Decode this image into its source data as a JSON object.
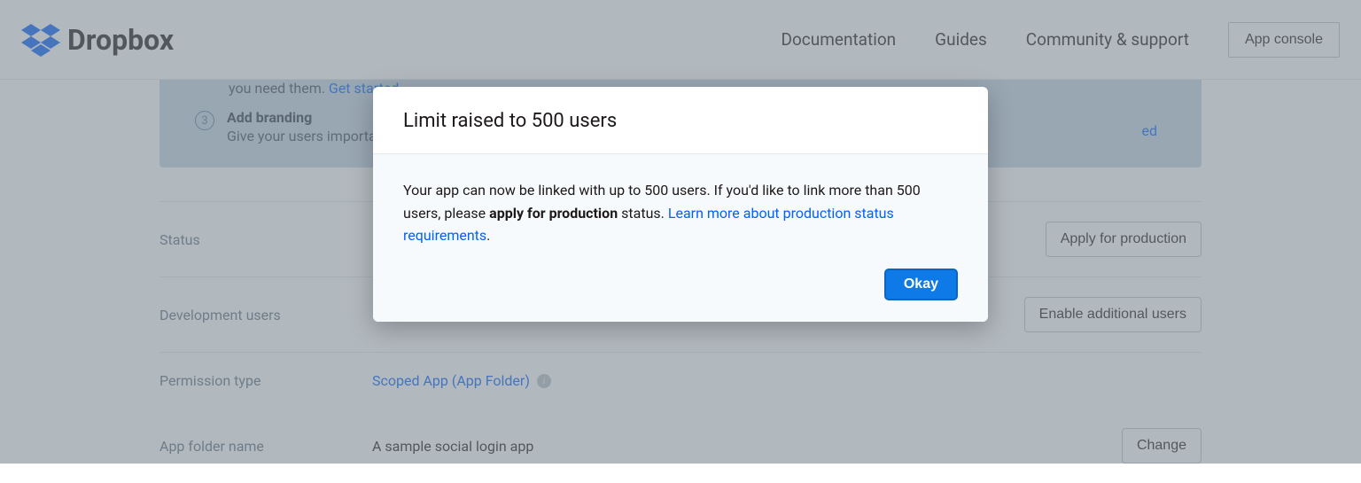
{
  "header": {
    "brand": "Dropbox",
    "nav": {
      "documentation": "Documentation",
      "guides": "Guides",
      "community": "Community & support"
    },
    "app_console": "App console"
  },
  "banner": {
    "line1_prefix": "you need them. ",
    "line1_link": "Get started",
    "step_number": "3",
    "step_title": "Add branding",
    "step_desc": "Give your users important in",
    "trail": "ed"
  },
  "settings": {
    "status": {
      "label": "Status",
      "button": "Apply for production"
    },
    "dev_users": {
      "label": "Development users",
      "button": "Enable additional users"
    },
    "permission": {
      "label": "Permission type",
      "value": "Scoped App (App Folder)"
    },
    "folder": {
      "label": "App folder name",
      "value": "A sample social login app",
      "button": "Change"
    }
  },
  "modal": {
    "title": "Limit raised to 500 users",
    "body_1": "Your app can now be linked with up to 500 users. If you'd like to link more than 500 users, please ",
    "body_bold": "apply for production",
    "body_2": " status. ",
    "body_link": "Learn more about production status requirements",
    "body_3": ".",
    "ok": "Okay"
  }
}
